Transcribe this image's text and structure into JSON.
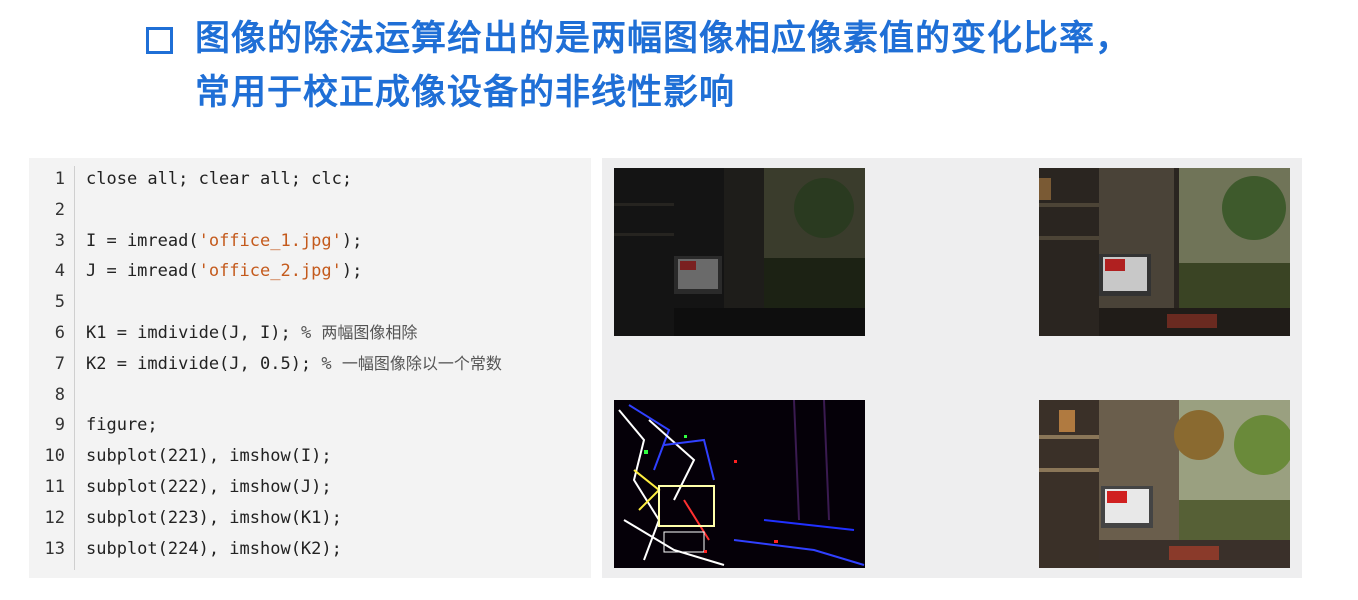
{
  "title": {
    "line1": "图像的除法运算给出的是两幅图像相应像素值的变化比率，",
    "line2": "常用于校正成像设备的非线性影响"
  },
  "code": [
    {
      "n": "1",
      "text": "close all; clear all; clc;"
    },
    {
      "n": "2",
      "text": ""
    },
    {
      "n": "3",
      "pre": "I = imread(",
      "str": "'office_1.jpg'",
      "post": ");"
    },
    {
      "n": "4",
      "pre": "J = imread(",
      "str": "'office_2.jpg'",
      "post": ");"
    },
    {
      "n": "5",
      "text": ""
    },
    {
      "n": "6",
      "pre": "K1 = imdivide(J, I); ",
      "pct": "% ",
      "cmt": "两幅图像相除"
    },
    {
      "n": "7",
      "pre": "K2 = imdivide(J, 0.5); ",
      "pct": "% ",
      "cmt": "一幅图像除以一个常数"
    },
    {
      "n": "8",
      "text": ""
    },
    {
      "n": "9",
      "text": "figure;"
    },
    {
      "n": "10",
      "text": "subplot(221), imshow(I);"
    },
    {
      "n": "11",
      "text": "subplot(222), imshow(J);"
    },
    {
      "n": "12",
      "text": "subplot(223), imshow(K1);"
    },
    {
      "n": "13",
      "text": "subplot(224), imshow(K2);"
    }
  ],
  "figures": [
    {
      "id": "I",
      "description_icon": "office-photo-dark"
    },
    {
      "id": "J",
      "description_icon": "office-photo-medium"
    },
    {
      "id": "K1",
      "description_icon": "division-result-noise"
    },
    {
      "id": "K2",
      "description_icon": "office-photo-bright"
    }
  ]
}
